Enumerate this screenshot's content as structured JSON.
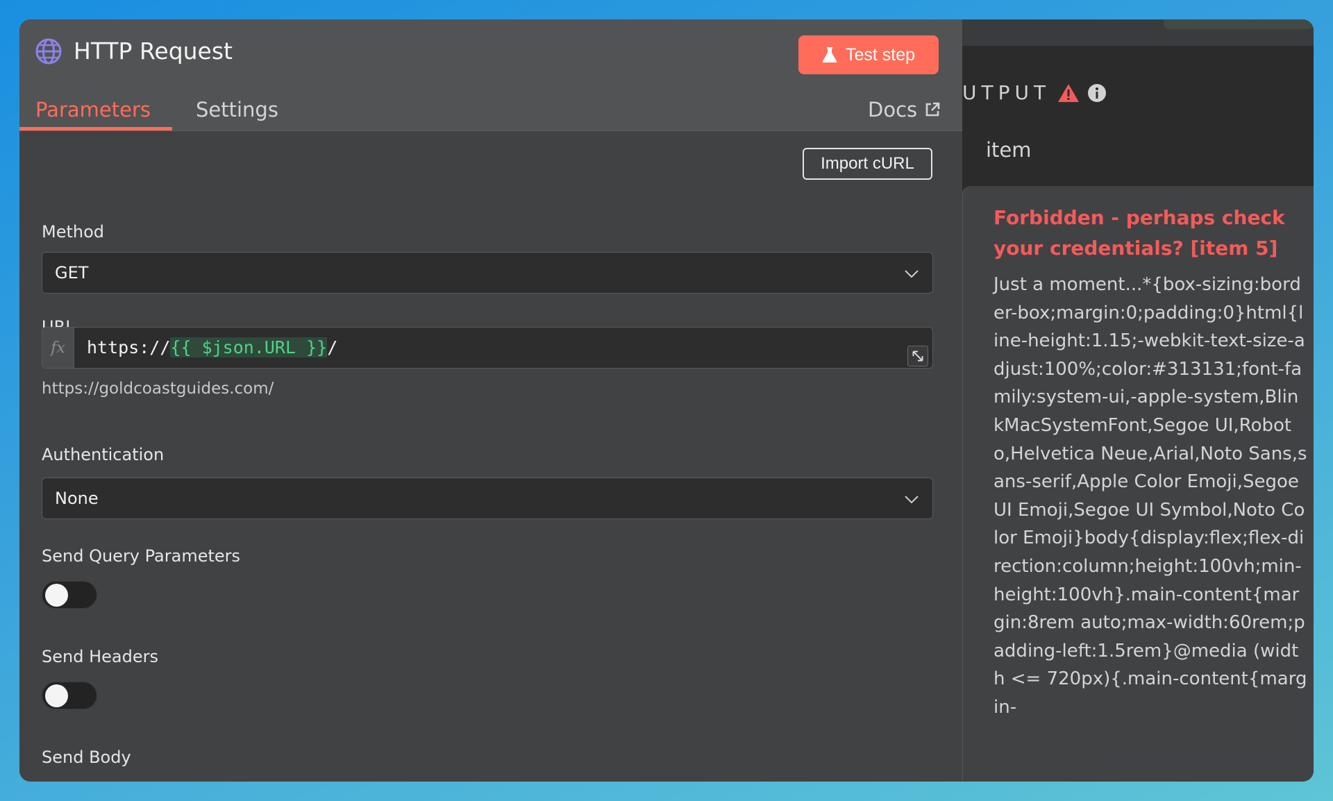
{
  "node": {
    "title": "HTTP Request",
    "test_button": "Test step",
    "tabs": [
      {
        "label": "Parameters"
      },
      {
        "label": "Settings"
      }
    ],
    "docs_link": "Docs"
  },
  "params": {
    "import_button": "Import cURL",
    "method": {
      "label": "Method",
      "value": "GET"
    },
    "url": {
      "label": "URL",
      "fx": "fx",
      "prefix": "https://",
      "expression": "{{ $json.URL }}",
      "suffix": "/",
      "resolved": "https://goldcoastguides.com/"
    },
    "authentication": {
      "label": "Authentication",
      "value": "None"
    },
    "send_query": {
      "label": "Send Query Parameters",
      "enabled": false
    },
    "send_headers": {
      "label": "Send Headers",
      "enabled": false
    },
    "send_body": {
      "label": "Send Body",
      "enabled": false
    }
  },
  "output": {
    "title": "UTPUT",
    "item_label": "item",
    "error_title": "Forbidden - perhaps check your credentials? [item 5]",
    "error_body": "Just a moment...*{box-sizing:border-box;margin:0;padding:0}html{line-height:1.15;-webkit-text-size-adjust:100%;color:#313131;font-family:system-ui,-apple-system,BlinkMacSystemFont,Segoe UI,Roboto,Helvetica Neue,Arial,Noto Sans,sans-serif,Apple Color Emoji,Segoe UI Emoji,Segoe UI Symbol,Noto Color Emoji}body{display:flex;flex-direction:column;height:100vh;min-height:100vh}.main-content{margin:8rem auto;max-width:60rem;padding-left:1.5rem}@media (width <= 720px){.main-content{margin-"
  },
  "colors": {
    "accent": "#ff6d5a",
    "error": "#f45a5a",
    "expression": "#4fd28a",
    "node_icon": "#8b83e8"
  },
  "icons": {
    "node": "globe-icon",
    "test": "flask-icon",
    "docs": "external-link-icon",
    "select": "chevron-down-icon",
    "expand": "expand-icon",
    "warning": "warning-icon",
    "info": "info-icon"
  }
}
